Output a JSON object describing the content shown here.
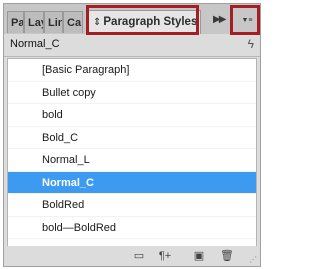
{
  "tabs": [
    {
      "label": "Pa"
    },
    {
      "label": "Lay"
    },
    {
      "label": "Lin"
    },
    {
      "label": "Ca"
    },
    {
      "label": "Paragraph Styles"
    }
  ],
  "panel": {
    "menu_symbol": "▼≡",
    "collapse_symbol": "▶▶",
    "current_style": "Normal_C",
    "selected_index": 5
  },
  "styles": [
    "[Basic Paragraph]",
    "Bullet copy",
    "bold",
    "Bold_C",
    "Normal_L",
    "Normal_C",
    "BoldRed",
    "bold—BoldRed"
  ],
  "colors": {
    "highlight": "#a41f24",
    "selection": "#3c9bf0"
  },
  "toolbar_icons": [
    "folder-icon",
    "paragraph-override-icon",
    "new-style-icon",
    "trash-icon"
  ]
}
